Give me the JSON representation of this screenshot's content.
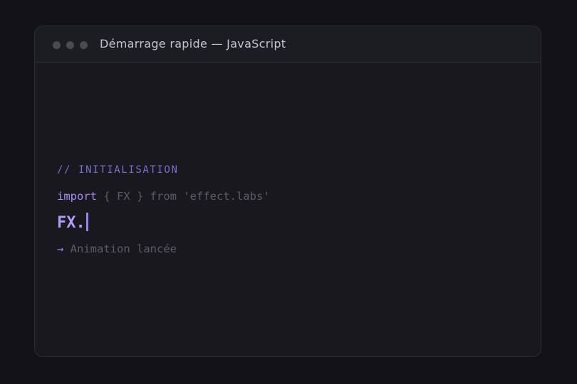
{
  "window": {
    "title": "Démarrage rapide — JavaScript"
  },
  "code": {
    "comment": "// INITIALISATION",
    "import_keyword": "import",
    "import_rest": " { FX } from 'effect.labs'",
    "typed_text": "FX.",
    "result_arrow": "→",
    "result_text": " Animation lancée"
  },
  "colors": {
    "background": "#121218",
    "window": "#18181e",
    "accent": "#a98ef6",
    "muted_text": "#5c5c64"
  },
  "icons": [
    "window-control-dot",
    "text-cursor"
  ]
}
